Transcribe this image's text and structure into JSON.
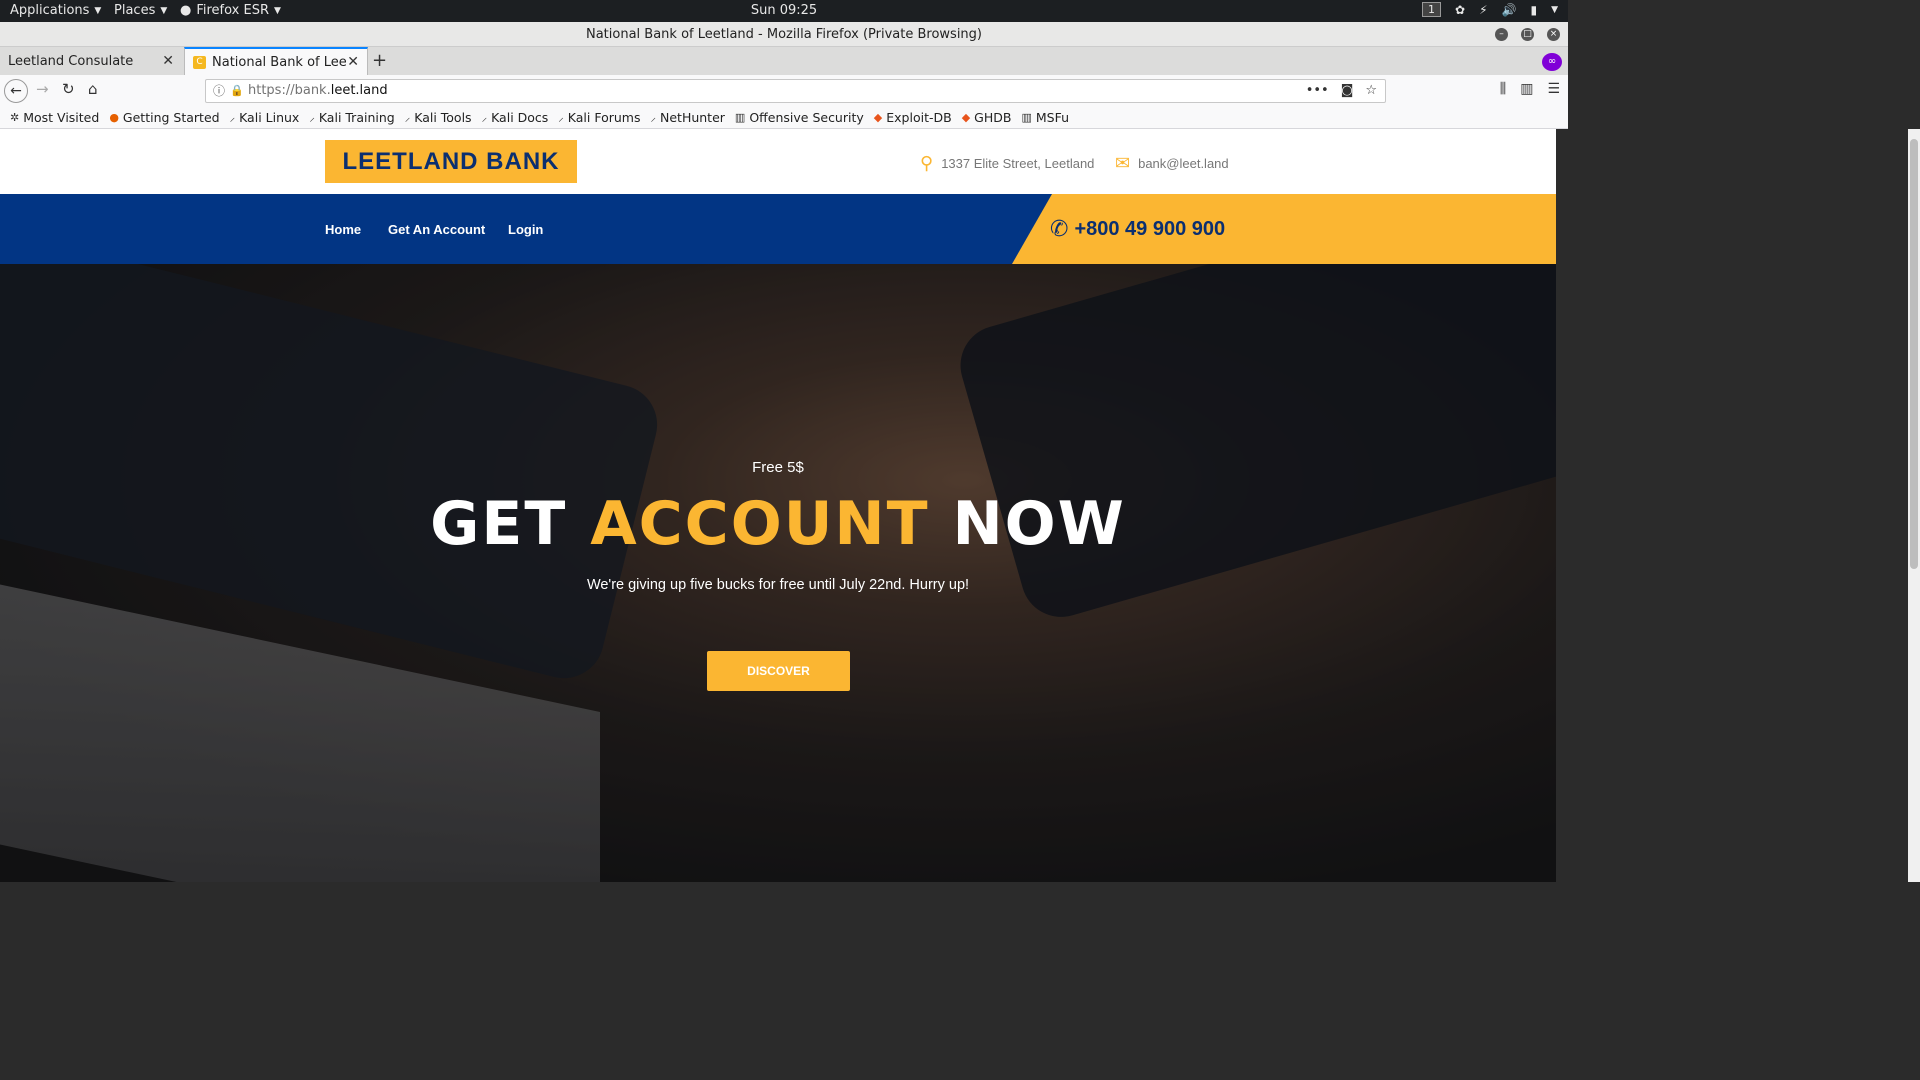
{
  "desktop": {
    "applications_label": "Applications",
    "places_label": "Places",
    "firefox_label": "Firefox ESR",
    "clock": "Sun 09:25",
    "workspace": "1"
  },
  "window": {
    "title": "National Bank of Leetland - Mozilla Firefox (Private Browsing)"
  },
  "tabs": [
    {
      "label": "Leetland Consulate"
    },
    {
      "label": "National Bank of Leetland"
    }
  ],
  "urlbar": {
    "url_prefix": "https://bank.",
    "url_domain": "leet.land"
  },
  "bookmarks": [
    {
      "label": "Most Visited",
      "icon": "gear-icon"
    },
    {
      "label": "Getting Started",
      "icon": "firefox-icon"
    },
    {
      "label": "Kali Linux",
      "icon": "kali-icon"
    },
    {
      "label": "Kali Training",
      "icon": "kali-icon"
    },
    {
      "label": "Kali Tools",
      "icon": "kali-icon"
    },
    {
      "label": "Kali Docs",
      "icon": "kali-icon"
    },
    {
      "label": "Kali Forums",
      "icon": "kali-icon"
    },
    {
      "label": "NetHunter",
      "icon": "kali-icon"
    },
    {
      "label": "Offensive Security",
      "icon": "offsec-icon"
    },
    {
      "label": "Exploit-DB",
      "icon": "exploitdb-icon"
    },
    {
      "label": "GHDB",
      "icon": "exploitdb-icon"
    },
    {
      "label": "MSFu",
      "icon": "offsec-icon"
    }
  ],
  "site": {
    "logo": "LEETLAND BANK",
    "address": "1337 Elite Street, Leetland",
    "email": "bank@leet.land",
    "nav": [
      "Home",
      "Get An Account",
      "Login"
    ],
    "phone": "+800 49 900 900",
    "hero": {
      "kicker": "Free 5$",
      "headline_part1": "GET ",
      "headline_accent": "ACCOUNT",
      "headline_part2": " NOW",
      "subtext": "We're giving up five bucks for free until July 22nd. Hurry up!",
      "button": "DISCOVER"
    },
    "colors": {
      "brand_yellow": "#fbb632",
      "brand_blue": "#023584"
    }
  }
}
